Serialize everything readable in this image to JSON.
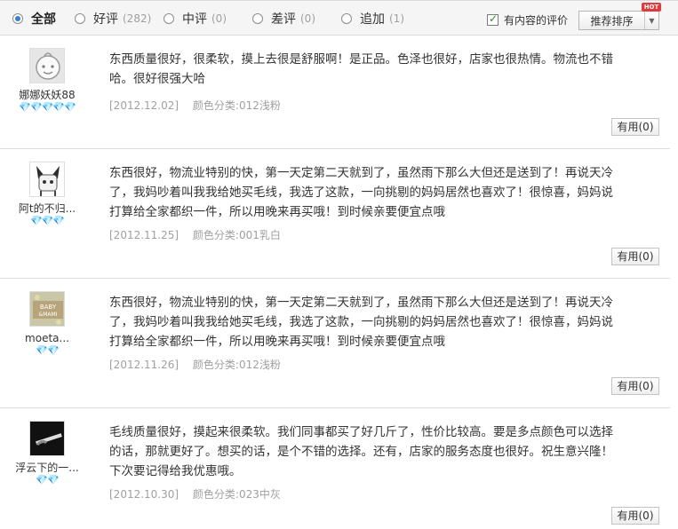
{
  "filters": [
    {
      "label": "全部",
      "count": "",
      "checked": true
    },
    {
      "label": "好评",
      "count": "(282)",
      "checked": false
    },
    {
      "label": "中评",
      "count": "(0)",
      "checked": false
    },
    {
      "label": "差评",
      "count": "(0)",
      "checked": false
    },
    {
      "label": "追加",
      "count": "(1)",
      "checked": false
    }
  ],
  "content_only": {
    "label": "有内容的评价",
    "checked": true
  },
  "sort": {
    "label": "推荐排序",
    "badge": "HOT"
  },
  "reviews": [
    {
      "username": "娜娜妖妖88",
      "hearts": "💎💎💎💎💎",
      "text": "东西质量很好，很柔软，摸上去很是舒服啊！是正品。色泽也很好，店家也很热情。物流也不错哈。很好很强大哈",
      "date": "[2012.12.02]",
      "color": "颜色分类:012浅粉",
      "useful": "有用(0)"
    },
    {
      "username": "阿t的不归...",
      "hearts": "💎💎💎",
      "text": "东西很好，物流业特别的快，第一天定第二天就到了，虽然雨下那么大但还是送到了！再说天冷了，我妈吵着叫我我给她买毛线，我选了这款，一向挑剔的妈妈居然也喜欢了！很惊喜，妈妈说打算给全家都织一件，所以用晚来再买哦！到时候亲要便宜点哦",
      "date": "[2012.11.25]",
      "color": "颜色分类:001乳白",
      "useful": "有用(0)"
    },
    {
      "username": "moeta...",
      "hearts": "💎💎",
      "text": "东西很好，物流业特别的快，第一天定第二天就到了，虽然雨下那么大但还是送到了！再说天冷了，我妈吵着叫我我给她买毛线，我选了这款，一向挑剔的妈妈居然也喜欢了！很惊喜，妈妈说打算给全家都织一件，所以用晚来再买哦！到时候亲要便宜点哦",
      "date": "[2012.11.26]",
      "color": "颜色分类:012浅粉",
      "useful": "有用(0)"
    },
    {
      "username": "浮云下的一...",
      "hearts": "💎💎",
      "text": "毛线质量很好，摸起来很柔软。我们同事都买了好几斤了，性价比较高。要是多点颜色可以选择的话，那就更好了。想买的话，是个不错的选择。还有，店家的服务态度也很好。祝生意兴隆！下次要记得给我优惠哦。",
      "date": "[2012.10.30]",
      "color": "颜色分类:023中灰",
      "useful": "有用(0)"
    }
  ]
}
